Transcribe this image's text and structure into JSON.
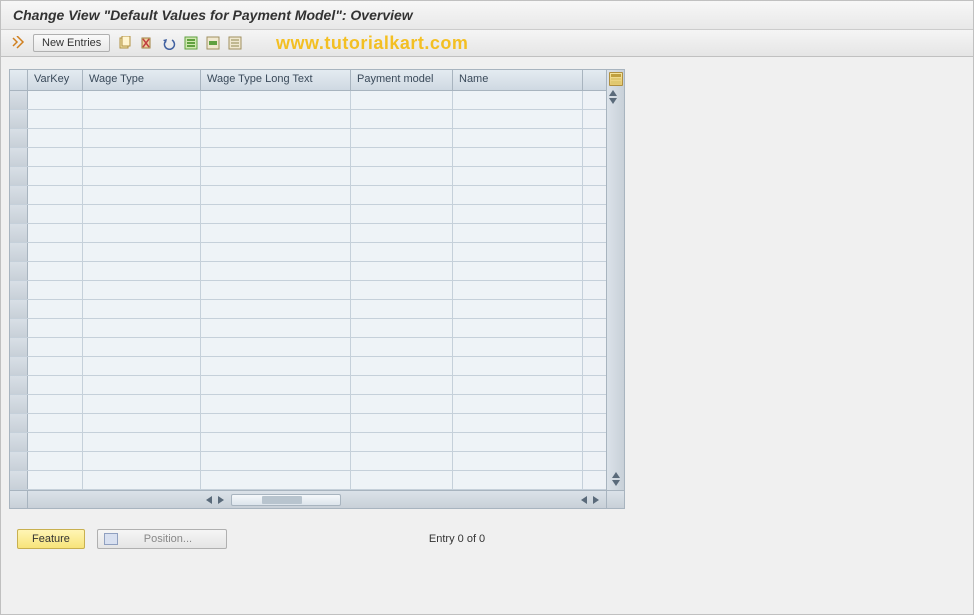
{
  "header": {
    "title": "Change View \"Default Values for Payment Model\": Overview"
  },
  "toolbar": {
    "new_entries_label": "New Entries"
  },
  "watermark": "www.tutorialkart.com",
  "grid": {
    "columns": {
      "varkey": "VarKey",
      "wagetype": "Wage Type",
      "wagelong": "Wage Type Long Text",
      "paymodel": "Payment model",
      "name": "Name"
    },
    "row_count": 21
  },
  "footer": {
    "feature_label": "Feature",
    "position_label": "Position...",
    "entry_text": "Entry 0 of 0"
  }
}
